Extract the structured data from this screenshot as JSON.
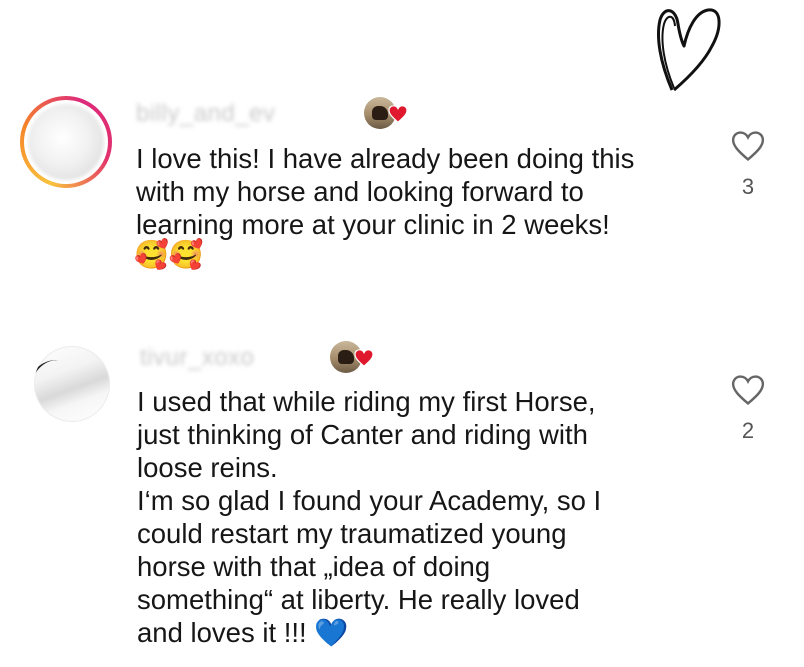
{
  "comments": [
    {
      "username": "billy_and_ev",
      "text": "I love this! I have already been doing this\nwith my horse and looking forward to\nlearning more at your clinic in 2 weeks!",
      "emojis": "🥰🥰",
      "likes": "3"
    },
    {
      "username": "tivur_xoxo",
      "text": "I used that while riding my first Horse,\njust thinking of Canter and riding with\nloose reins.\nI‘m so glad I found your Academy, so I\ncould restart my traumatized young\nhorse with that „idea of doing\nsomething“ at liberty. He really loved\nand loves it !!! 💙",
      "likes": "2"
    }
  ],
  "icons": {
    "like": "heart-outline-icon",
    "author_liked": "red-heart-icon",
    "decoration": "hand-drawn-heart-icon"
  },
  "colors": {
    "author_heart": "#e0182d",
    "text": "#161616",
    "muted": "#555555"
  }
}
